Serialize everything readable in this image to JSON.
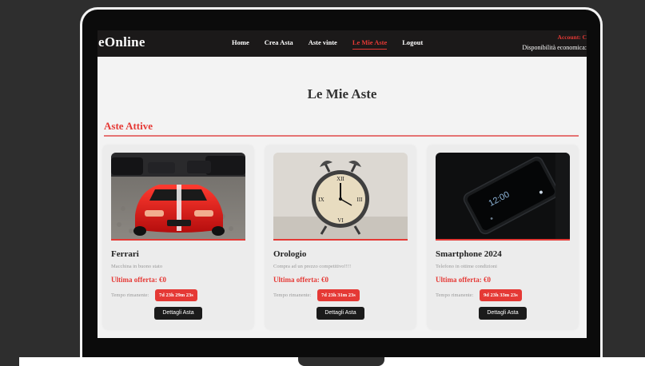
{
  "navbar": {
    "logo": "eOnline",
    "links": [
      "Home",
      "Crea Asta",
      "Aste vinte",
      "Le Mie Aste",
      "Logout"
    ],
    "active_index": 3,
    "account_label": "Account: C",
    "balance_label": "Disponibilità economica:"
  },
  "page": {
    "title": "Le Mie Aste",
    "section_title": "Aste Attive"
  },
  "cards": [
    {
      "image_icon": "red-sports-car-image",
      "title": "Ferrari",
      "description": "Macchina in buono stato",
      "offer": "Ultima offerta: €0",
      "time_label": "Tempo rimanente:",
      "timer": "7d 23h 29m 23s",
      "button": "Dettagli Asta"
    },
    {
      "image_icon": "alarm-clock-image",
      "title": "Orologio",
      "description": "Compra ad un prezzo competitivo!!!!",
      "offer": "Ultima offerta: €0",
      "time_label": "Tempo rimanente:",
      "timer": "7d 23h 31m 23s",
      "button": "Dettagli Asta"
    },
    {
      "image_icon": "smartphone-image",
      "title": "Smartphone 2024",
      "description": "Telefono in ottime condizioni",
      "offer": "Ultima offerta: €0",
      "time_label": "Tempo rimanente:",
      "timer": "9d 23h 33m 23s",
      "button": "Dettagli Asta"
    }
  ],
  "colors": {
    "accent": "#e53935",
    "navbar_bg": "#1b1919",
    "page_bg": "#f3f3f3",
    "outer_bg": "#2e2e2e"
  }
}
